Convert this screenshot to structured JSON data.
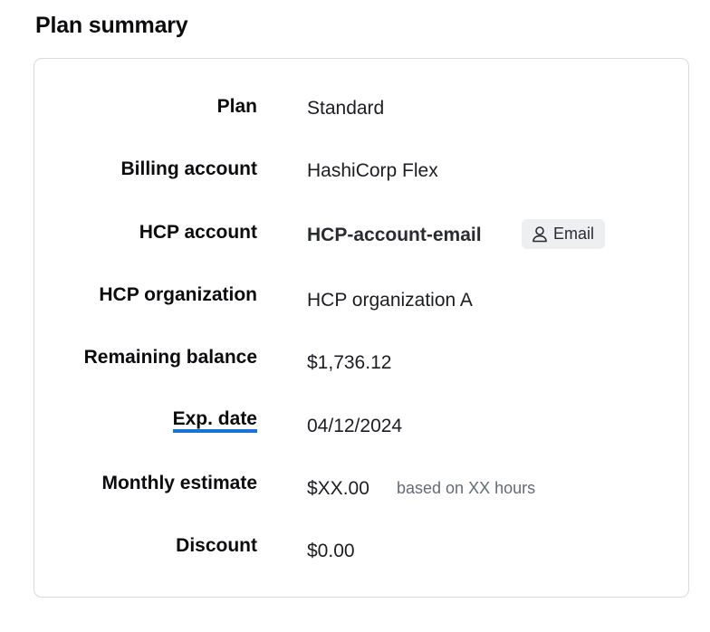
{
  "section": {
    "title": "Plan summary"
  },
  "summary": {
    "plan": {
      "label": "Plan",
      "value": "Standard"
    },
    "billing_account": {
      "label": "Billing account",
      "value": "HashiCorp Flex"
    },
    "hcp_account": {
      "label": "HCP account",
      "value": "HCP-account-email",
      "badge_label": "Email",
      "badge_icon": "user-icon"
    },
    "hcp_organization": {
      "label": "HCP organization",
      "value": "HCP organization A"
    },
    "remaining_balance": {
      "label": "Remaining balance",
      "value": "$1,736.12"
    },
    "exp_date": {
      "label": "Exp. date",
      "value": "04/12/2024"
    },
    "monthly_estimate": {
      "label": "Monthly estimate",
      "value": "$XX.00",
      "hint": "based on XX hours"
    },
    "discount": {
      "label": "Discount",
      "value": "$0.00"
    }
  },
  "colors": {
    "tooltip_underline": "#1c73d6",
    "badge_background": "#eeeff1",
    "border": "#d9dadd",
    "hint_text": "#656a76"
  }
}
